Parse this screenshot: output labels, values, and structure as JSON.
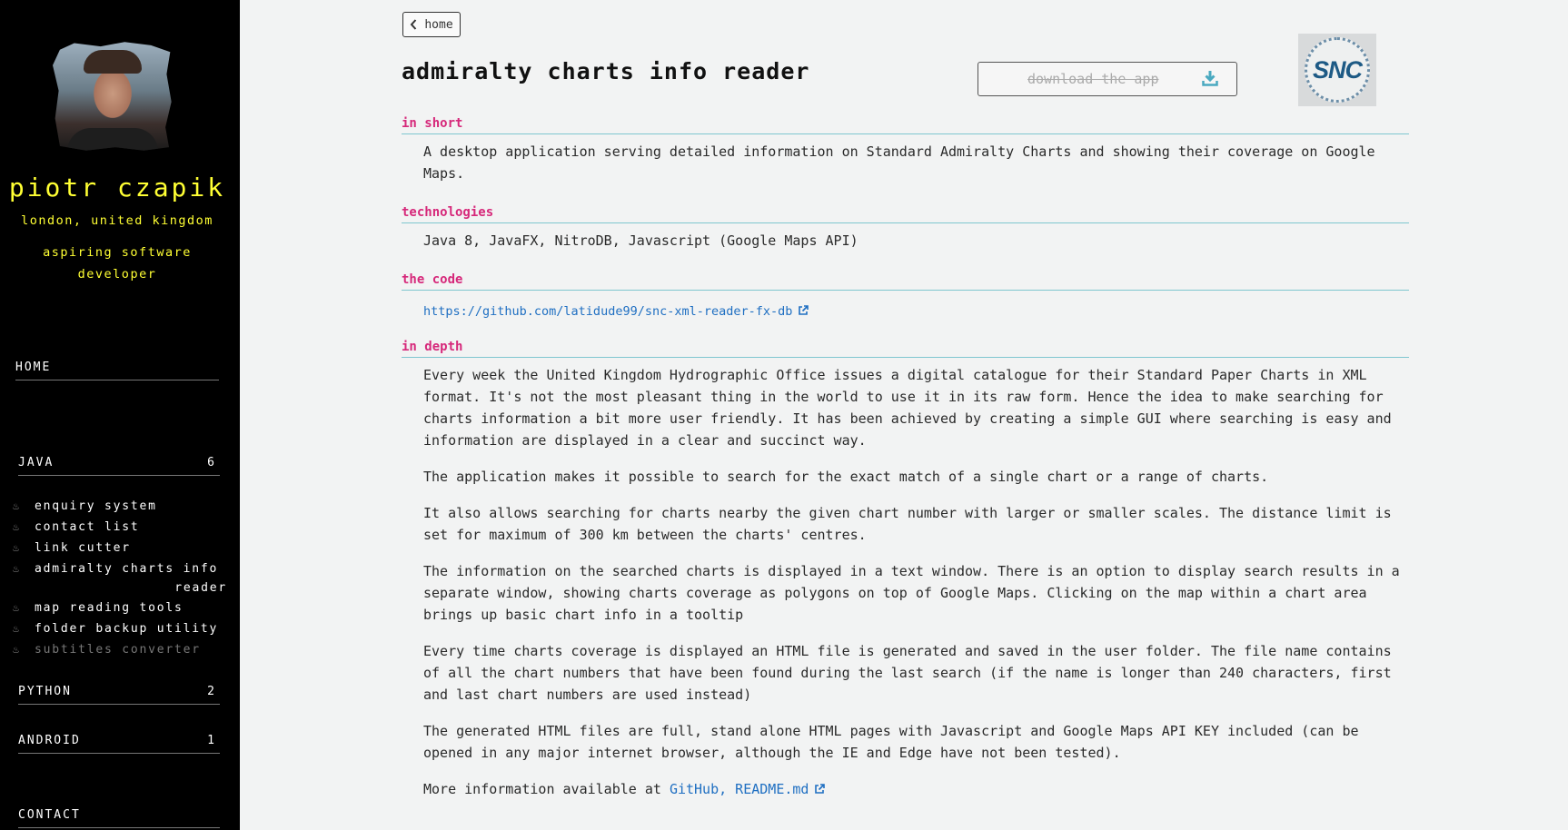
{
  "sidebar": {
    "name": "piotr czapik",
    "location": "london, united kingdom",
    "role": "aspiring software developer",
    "nav_home": "HOME",
    "java": {
      "label": "JAVA",
      "count": "6",
      "items": [
        {
          "label": "enquiry system"
        },
        {
          "label": "contact list"
        },
        {
          "label": "link cutter"
        },
        {
          "label": "admiralty charts info",
          "label_cont": "reader"
        },
        {
          "label": "map reading tools"
        },
        {
          "label": "folder backup utility"
        },
        {
          "label": "subtitles converter"
        }
      ]
    },
    "python": {
      "label": "PYTHON",
      "count": "2"
    },
    "android": {
      "label": "ANDROID",
      "count": "1"
    },
    "contact": "CONTACT"
  },
  "main": {
    "home_button": "home",
    "title": "admiralty charts info reader",
    "download_button": "download the app",
    "logo_text": "SNC",
    "sections": {
      "in_short": {
        "heading": "in short",
        "text": "A desktop application serving detailed information on Standard Admiralty Charts and showing their coverage on Google Maps."
      },
      "technologies": {
        "heading": "technologies",
        "text": "Java 8, JavaFX, NitroDB, Javascript (Google Maps API)"
      },
      "the_code": {
        "heading": "the code",
        "link": "https://github.com/latidude99/snc-xml-reader-fx-db"
      },
      "in_depth": {
        "heading": "in depth",
        "paragraphs": [
          "Every week the United Kingdom Hydrographic Office issues a digital catalogue for their Standard Paper Charts in XML format. It's not the most pleasant thing in the world to use it in its raw form. Hence the idea to make searching for charts information a bit more user friendly. It has been achieved by creating a simple GUI where searching is easy and information are displayed in a clear and succinct way.",
          "The application makes it possible to search for the exact match of a single chart or a range of charts.",
          "It also allows searching for charts nearby the given chart number with larger or smaller scales. The distance limit is set for maximum of 300 km between the charts' centres.",
          "The information on the searched charts is displayed in a text window. There is an option to display search results in a separate window, showing charts coverage as polygons on top of Google Maps. Clicking on the map within a chart area brings up basic chart info in a tooltip",
          "Every time charts coverage is displayed an HTML file is generated and saved in the user folder. The file name contains of all the chart numbers that have been found during the last search (if the name is longer than 240 characters, first and last chart numbers are used instead)",
          "The generated HTML files are full, stand alone HTML pages with Javascript and Google Maps API KEY included (can be opened in any major internet browser, although the IE and Edge have not been tested)."
        ],
        "more_prefix": "More information available at",
        "more_link": "GitHub, README.md"
      }
    }
  },
  "colors": {
    "accent_heading": "#d6287a",
    "rule": "#7fc6cf",
    "link": "#1f6fc2",
    "sidebar_text": "#ffff33"
  }
}
